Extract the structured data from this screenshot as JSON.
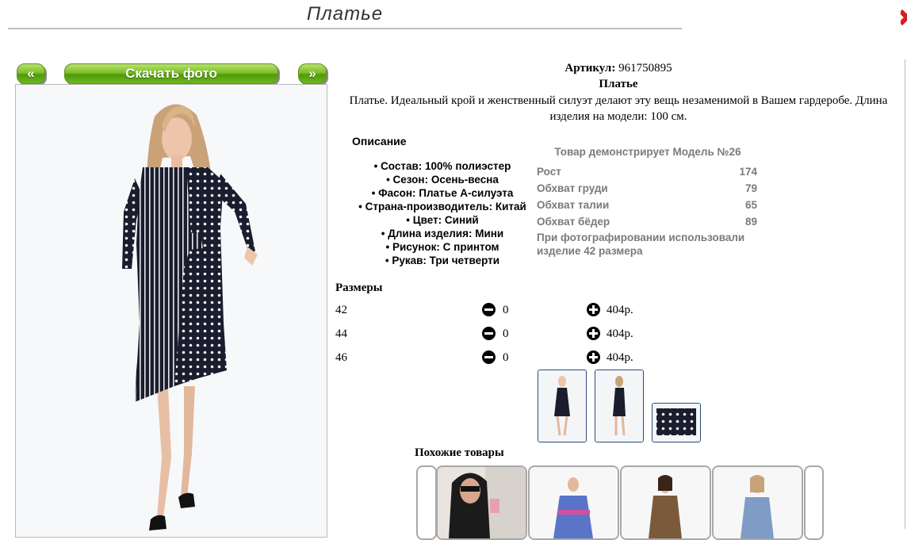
{
  "page": {
    "title": "Платье"
  },
  "nav": {
    "prev": "«",
    "download": "Скачать фото",
    "next": "»"
  },
  "product": {
    "article_label": "Артикул:",
    "article_value": "961750895",
    "name": "Платье",
    "description": "Платье. Идеальный крой и женственный силуэт делают эту вещь незаменимой в Вашем гардеробе. Длина изделия на модели: 100 см."
  },
  "description_section": {
    "title": "Описание",
    "features": [
      "Состав: 100% полиэстер",
      "Сезон: Осень-весна",
      "Фасон: Платье А-силуэта",
      "Страна-производитель: Китай",
      "Цвет: Синий",
      "Длина изделия: Мини",
      "Рисунок: С принтом",
      "Рукав: Три четверти"
    ]
  },
  "model": {
    "header": "Товар демонстрирует Модель №26",
    "rows": [
      {
        "label": "Рост",
        "value": "174"
      },
      {
        "label": "Обхват груди",
        "value": "79"
      },
      {
        "label": "Обхват талии",
        "value": "65"
      },
      {
        "label": "Обхват бёдер",
        "value": "89"
      }
    ],
    "note": "При фотографировании использовали изделие 42 размера"
  },
  "sizes": {
    "title": "Размеры",
    "rows": [
      {
        "size": "42",
        "qty": "0",
        "price": "404р."
      },
      {
        "size": "44",
        "qty": "0",
        "price": "404р."
      },
      {
        "size": "46",
        "qty": "0",
        "price": "404р."
      }
    ]
  },
  "similar": {
    "title": "Похожие товары"
  },
  "colors": {
    "accent_green": "#6fb81f",
    "thumb_border": "#2a4a7a",
    "dress_navy": "#1a1d2e"
  }
}
